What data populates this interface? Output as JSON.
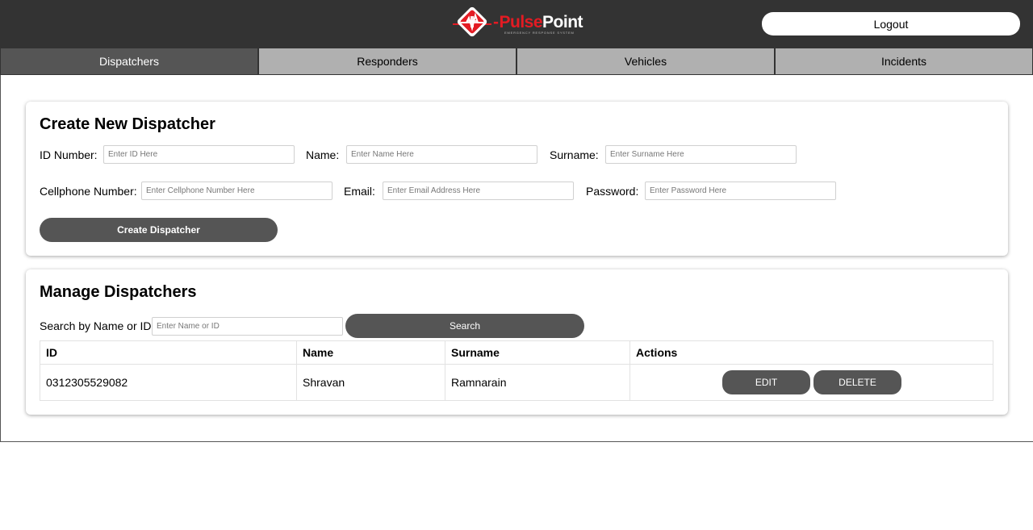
{
  "brand": {
    "pulse": "Pulse",
    "point": "Point",
    "tagline": "EMERGENCY RESPONSE SYSTEM",
    "colors": {
      "red": "#e31b23",
      "dark": "#333333"
    }
  },
  "header": {
    "logout_label": "Logout"
  },
  "tabs": [
    {
      "label": "Dispatchers",
      "active": true
    },
    {
      "label": "Responders",
      "active": false
    },
    {
      "label": "Vehicles",
      "active": false
    },
    {
      "label": "Incidents",
      "active": false
    }
  ],
  "create": {
    "title": "Create New Dispatcher",
    "fields": {
      "id": {
        "label": "ID Number:",
        "placeholder": "Enter ID Here",
        "value": ""
      },
      "name": {
        "label": "Name:",
        "placeholder": "Enter Name Here",
        "value": ""
      },
      "surname": {
        "label": "Surname:",
        "placeholder": "Enter Surname Here",
        "value": ""
      },
      "cell": {
        "label": "Cellphone Number:",
        "placeholder": "Enter Cellphone Number Here",
        "value": ""
      },
      "email": {
        "label": "Email:",
        "placeholder": "Enter Email Address Here",
        "value": ""
      },
      "password": {
        "label": "Password:",
        "placeholder": "Enter Password Here",
        "value": ""
      }
    },
    "submit_label": "Create Dispatcher"
  },
  "manage": {
    "title": "Manage Dispatchers",
    "search_label": "Search by Name or ID:",
    "search_placeholder": "Enter Name or ID",
    "search_button": "Search",
    "columns": [
      "ID",
      "Name",
      "Surname",
      "Actions"
    ],
    "rows": [
      {
        "id": "0312305529082",
        "name": "Shravan",
        "surname": "Ramnarain",
        "edit": "EDIT",
        "delete": "DELETE"
      }
    ]
  }
}
